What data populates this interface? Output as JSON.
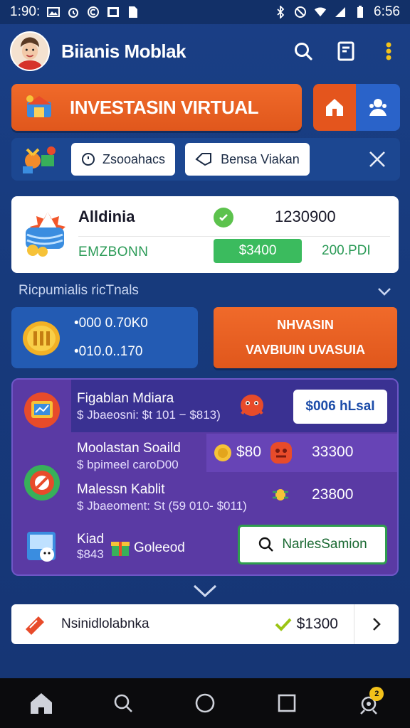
{
  "status_bar": {
    "time": "1:90:",
    "clock_right": "6:56",
    "icons": [
      "image-icon",
      "alarm-icon",
      "circle-c-icon",
      "gallery-icon",
      "file-icon",
      "bluetooth-icon",
      "mute-icon",
      "wifi-icon",
      "signal-icon",
      "battery-icon"
    ]
  },
  "app_bar": {
    "title": "Biianis Moblak",
    "icons": [
      "avatar",
      "search-icon",
      "document-icon",
      "more-vert-icon"
    ]
  },
  "banner": {
    "label": "INVESTASIN VIRTUAL",
    "icon": "investment-chest-icon",
    "toggle_icons": [
      "home-icon",
      "people-icon"
    ],
    "colors": {
      "orange": "#e0571c",
      "blue": "#2a63c9"
    }
  },
  "filters": {
    "chip1": "Zsooahacs",
    "chip2": "Bensa Viakan",
    "icons": [
      "gifts-icon",
      "clock-icon",
      "tag-icon",
      "close-icon"
    ]
  },
  "summary_card": {
    "name": "Alldinia",
    "subtitle": "EMZBONN",
    "amount": "1230900",
    "button": "$3400",
    "right_value": "200.PDI",
    "icon": "sun-cash-icon",
    "check_icon": "check-circle-icon"
  },
  "section": {
    "label": "Ricpumialis ricTnals",
    "chevron": "chevron-down-icon"
  },
  "portfolio": {
    "line1": "•000 0.70K0",
    "line2": "•010.0..170",
    "icon": "coin-stack-icon"
  },
  "cta": {
    "line1": "NHVASIN",
    "line2": "VAVBIUIN UVASUIA"
  },
  "items": [
    {
      "title": "Figablan Mdiara",
      "sub": "$ Jbaeosni: $t 101 − $813)",
      "button": "$006 hLsaI",
      "icons": [
        "chart-card-icon",
        "monster-icon"
      ]
    },
    {
      "title": "Moolastan Soaild",
      "sub": "$ bpimeel caroD00",
      "value_a": "$80",
      "value_b": "33300",
      "icons": [
        "coin-icon",
        "badge-icon"
      ]
    },
    {
      "title": "Malessn Kablit",
      "sub": "$ Jbaeoment: St (59 010- $011)",
      "value_b": "23800",
      "icons": [
        "target-ring-icon",
        "bug-icon"
      ]
    },
    {
      "title": "Kiad",
      "sub": "$843",
      "extra": "Goleeod",
      "button": "NarlesSamion",
      "icons": [
        "shop-icon",
        "gift-icon",
        "search-icon"
      ]
    }
  ],
  "bottom": {
    "label": "Nsinidlolabnka",
    "value": "$1300",
    "icons": [
      "ticket-icon",
      "check-icon",
      "chevron-right-icon"
    ]
  },
  "nav": {
    "badge": "2",
    "icons": [
      "home-icon",
      "search-icon",
      "circle-home-icon",
      "square-icon",
      "settings-icon"
    ]
  }
}
